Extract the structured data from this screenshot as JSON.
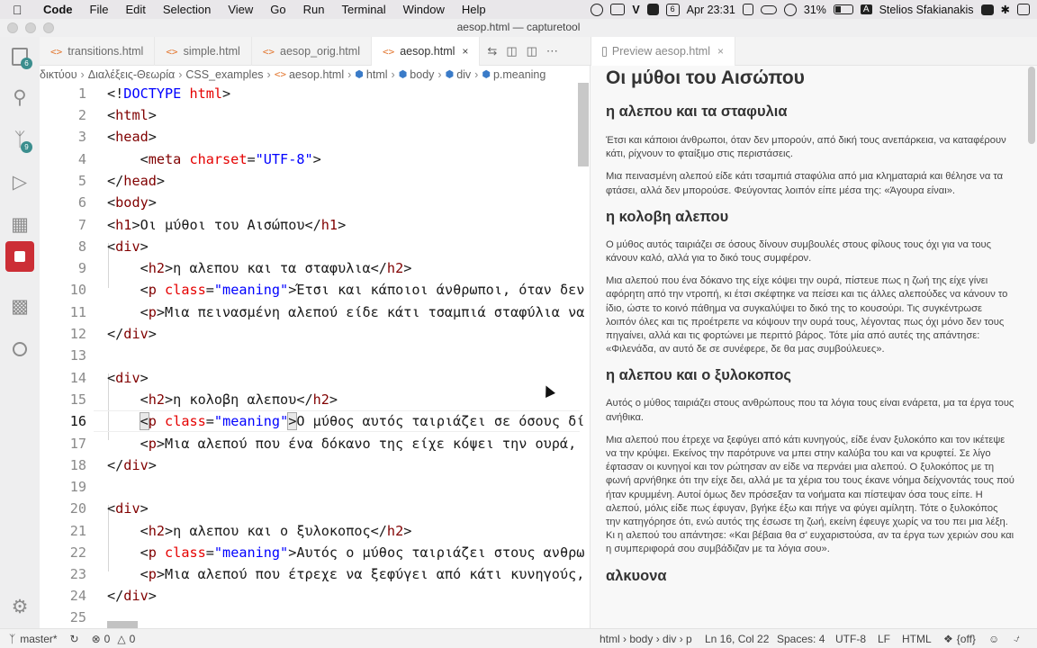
{
  "menubar": {
    "items": [
      "Code",
      "File",
      "Edit",
      "Selection",
      "View",
      "Go",
      "Run",
      "Terminal",
      "Window",
      "Help"
    ],
    "date_badge": "6",
    "clock": "Apr 23:31",
    "battery": "31%",
    "user_initial": "A",
    "user": "Stelios Sfakianakis"
  },
  "window": {
    "title": "aesop.html — capturetool"
  },
  "activity": {
    "explorer_badge": "6",
    "scm_badge": "9"
  },
  "tabs": {
    "editor": [
      {
        "label": "transitions.html"
      },
      {
        "label": "simple.html"
      },
      {
        "label": "aesop_orig.html"
      },
      {
        "label": "aesop.html",
        "close": "×"
      }
    ],
    "preview": {
      "label": "Preview aesop.html",
      "close": "×"
    }
  },
  "breadcrumb": [
    "δικτύου",
    "Διαλέξεις-Θεωρία",
    "CSS_examples",
    "aesop.html",
    "html",
    "body",
    "div",
    "p.meaning"
  ],
  "editor": {
    "line_numbers": [
      "1",
      "2",
      "3",
      "4",
      "5",
      "6",
      "7",
      "8",
      "9",
      "10",
      "11",
      "12",
      "13",
      "14",
      "15",
      "16",
      "17",
      "18",
      "19",
      "20",
      "21",
      "22",
      "23",
      "24",
      "25"
    ],
    "current_line": 16,
    "lines": [
      "1",
      "2",
      "3",
      "4",
      "5",
      "6",
      "7",
      "8",
      "9",
      "10",
      "11",
      "12",
      "13",
      "14",
      "15",
      "16",
      "17",
      "18",
      "19",
      "20",
      "21",
      "22",
      "23",
      "24",
      "25"
    ],
    "text": {
      "l1_doctype": "DOCTYPE",
      "l1_html": "html",
      "l4_charset_value": "\"UTF-8\"",
      "l7_text": "Οι μύθοι του Αισώπου",
      "l9_text": "η αλεπου και τα σταφυλια",
      "l10_text": "Έτσι και κάποιοι άνθρωποι, όταν δεν",
      "l11_text": "Μια πεινασμένη αλεπού είδε κάτι τσαμπιά σταφύλια να",
      "l15_text": "η κολοβη αλεπου",
      "l16_text": "Ο μύθος αυτός ταιριάζει σε όσους δί",
      "l17_text": "Μια αλεπού που ένα δόκανο της είχε κόψει την ουρά,",
      "l21_text": "η αλεπου και ο ξυλοκοπος",
      "l22_text": "Αυτός ο μύθος ταιριάζει στους ανθρω",
      "l23_text": "Μια αλεπού που έτρεχε να ξεφύγει από κάτι κυνηγούς,",
      "class_attr": "class",
      "class_value": "\"meaning\"",
      "charset_attr": "charset"
    }
  },
  "preview": {
    "h1": "Οι μύθοι του Αισώπου",
    "sections": [
      {
        "title": "η αλεπου και τα σταφυλια",
        "meaning": "Έτσι και κάποιοι άνθρωποι, όταν δεν μπορούν, από δική τους ανεπάρκεια, να καταφέρουν κάτι, ρίχνουν το φταίξιμο στις περιστάσεις.",
        "story": "Μια πεινασμένη αλεπού είδε κάτι τσαμπιά σταφύλια από μια κληματαριά και θέλησε να τα φτάσει, αλλά δεν μπορούσε. Φεύγοντας λοιπόν είπε μέσα της: «Άγουρα είναι»."
      },
      {
        "title": "η κολοβη αλεπου",
        "meaning": "Ο μύθος αυτός ταιριάζει σε όσους δίνουν συμβουλές στους φίλους τους όχι για να τους κάνουν καλό, αλλά για το δικό τους συμφέρον.",
        "story": "Μια αλεπού που ένα δόκανο της είχε κόψει την ουρά, πίστευε πως η ζωή της είχε γίνει αφόρητη από την ντροπή, κι έτσι σκέφτηκε να πείσει και τις άλλες αλεπούδες να κάνουν το ίδιο, ώστε το κοινό πάθημα να συγκαλύψει το δικό της το κουσούρι. Τις συγκέντρωσε λοιπόν όλες και τις προέτρεπε να κόψουν την ουρά τους, λέγοντας πως όχι μόνο δεν τους πηγαίνει, αλλά και τις φορτώνει με περιττό βάρος. Τότε μία από αυτές της απάντησε: «Φιλενάδα, αν αυτό δε σε συνέφερε, δε θα μας συμβούλευες»."
      },
      {
        "title": "η αλεπου και ο ξυλοκοπος",
        "meaning": "Αυτός ο μύθος ταιριάζει στους ανθρώπους που τα λόγια τους είναι ενάρετα, μα τα έργα τους ανήθικα.",
        "story": "Μια αλεπού που έτρεχε να ξεφύγει από κάτι κυνηγούς, είδε έναν ξυλοκόπο και τον ικέτεψε να την κρύψει. Εκείνος την παρότρυνε να μπει στην καλύβα του και να κρυφτεί. Σε λίγο έφτασαν οι κυνηγοί και τον ρώτησαν αν είδε να περνάει μια αλεπού. Ο ξυλοκόπος με τη φωνή αρνήθηκε ότι την είχε δει, αλλά με τα χέρια του τους έκανε νόημα δείχνοντάς τους πού ήταν κρυμμένη. Αυτοί όμως δεν πρόσεξαν τα νοήματα και πίστεψαν όσα τους είπε. Η αλεπού, μόλις είδε πως έφυγαν, βγήκε έξω και πήγε να φύγει αμίλητη. Τότε ο ξυλοκόπος την κατηγόρησε ότι, ενώ αυτός της έσωσε τη ζωή, εκείνη έφευγε χωρίς να του πει μια λέξη. Κι η αλεπού του απάντησε: «Και βέβαια θα σ' ευχαριστούσα, αν τα έργα των χεριών σου και η συμπεριφορά σου συμβάδιζαν με τα λόγια σου»."
      },
      {
        "title": "αλκυονα"
      }
    ]
  },
  "statusbar": {
    "branch": "master*",
    "errors": "0",
    "warnings": "0",
    "path": "html › body › div › p",
    "position": "Ln 16, Col 22",
    "spaces": "Spaces: 4",
    "encoding": "UTF-8",
    "eol": "LF",
    "language": "HTML",
    "toggle": "{off}"
  }
}
